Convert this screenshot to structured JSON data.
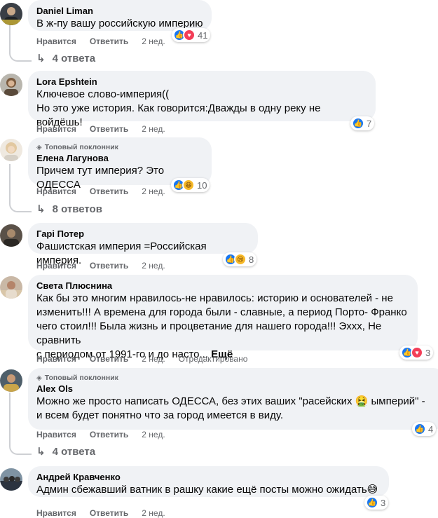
{
  "colors": {
    "bubble": "#f0f2f5",
    "secondary_text": "#65676b",
    "like_blue": "#1877f2",
    "love_red": "#f33e58",
    "haha_yellow": "#f7b928"
  },
  "actions": {
    "like": "Нравится",
    "reply": "Ответить",
    "time": "2 нед.",
    "edited": "Отредактировано",
    "more": "Ещё"
  },
  "badge": "Топовый поклонник",
  "comments": [
    {
      "name": "Daniel Liman",
      "text": "В ж-пу вашу российскую империю",
      "reactions": [
        "like",
        "love"
      ],
      "count": "41",
      "replies": "4 ответа"
    },
    {
      "name": "Lora Epshtein",
      "text": "Ключевое слово-империя((\nНо это уже история. Как говорится:Дважды в одну реку не войдёшь!",
      "reactions": [
        "like"
      ],
      "count": "7"
    },
    {
      "name": "Елена Лагунова",
      "text": "Причем тут империя? Это ОДЕССА",
      "reactions": [
        "like",
        "haha"
      ],
      "count": "10",
      "replies": "8 ответов"
    },
    {
      "name": "Гарі Потер",
      "text": "Фашистская империя =Российская империя.",
      "reactions": [
        "like",
        "sad"
      ],
      "count": "8"
    },
    {
      "name": "Света Плюснина",
      "text": "Как бы это многим нравилось-не нравилось: историю и основателей - не\nизменить!!! А времена для города были - славные, а период Порто- Франко\nчего стоил!!! Была жизнь и процветание для нашего города!!! Эххх, Не сравнить\nс периодом от 1991-го и до насто...",
      "reactions": [
        "like",
        "love"
      ],
      "count": "3"
    },
    {
      "name": "Alex Ols",
      "text": "Можно же просто написать ОДЕССА, без этих ваших \"расейских 🤮 ымперий\" -\nи всем будет понятно что за город имеется в виду.",
      "reactions": [
        "like"
      ],
      "count": "4",
      "replies": "4 ответа"
    },
    {
      "name": "Андрей Кравченко",
      "text": "Админ сбежавший ватник в рашку какие ещё посты можно ожидать😅",
      "reactions": [
        "like"
      ],
      "count": "3"
    }
  ]
}
